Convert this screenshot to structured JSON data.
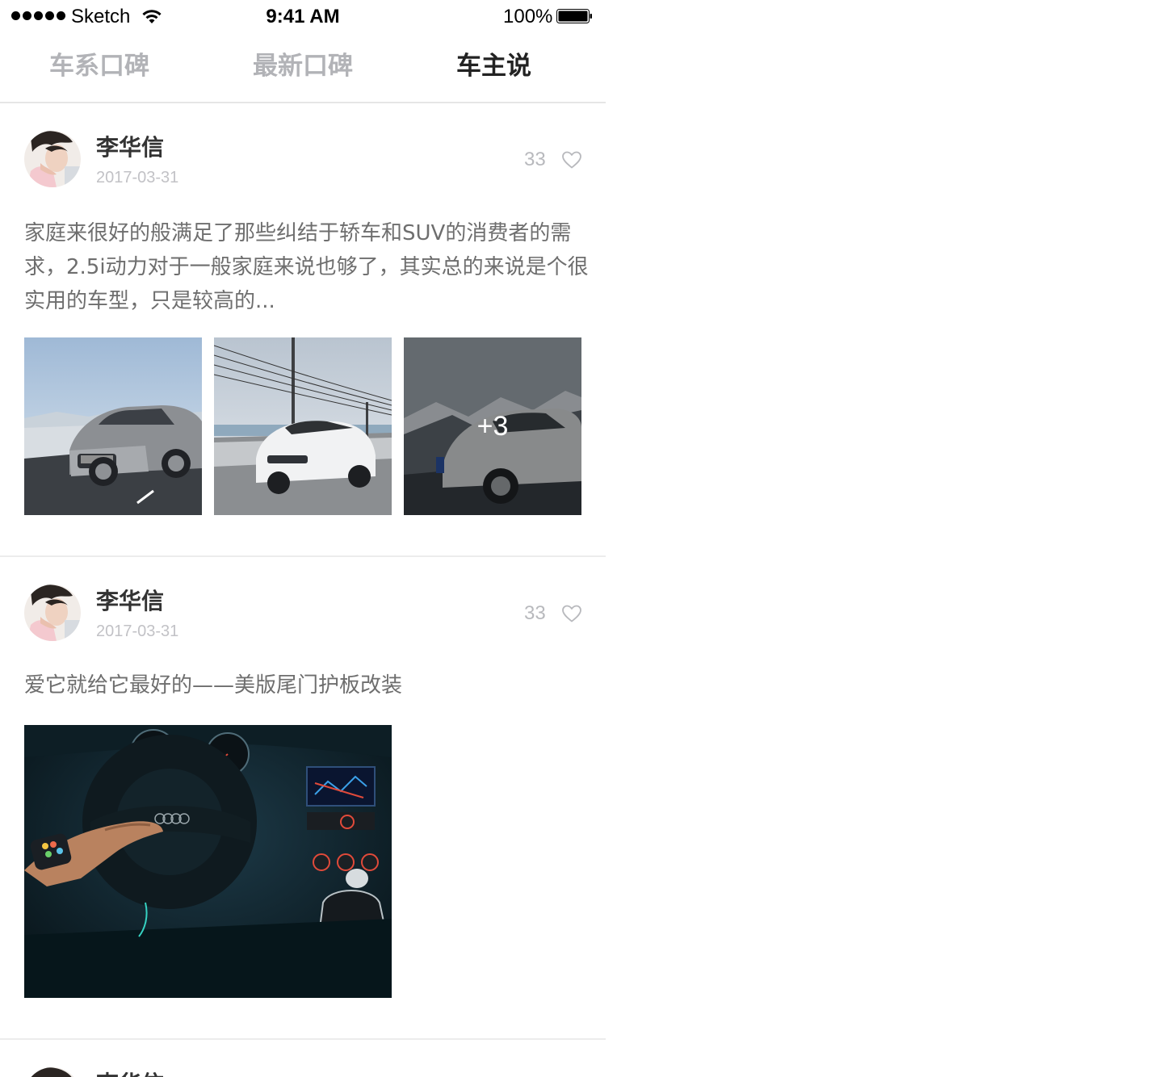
{
  "status_bar": {
    "carrier": "Sketch",
    "time": "9:41 AM",
    "battery": "100%"
  },
  "tabs": [
    {
      "label": "车系口碑",
      "active": false
    },
    {
      "label": "最新口碑",
      "active": false
    },
    {
      "label": "车主说",
      "active": true
    }
  ],
  "posts": [
    {
      "author": "李华信",
      "date": "2017-03-31",
      "likes": "33",
      "text": "家庭来很好的般满足了那些纠结于轿车和SUV的消费者的需求，2.5i动力对于一般家庭来说也够了，其实总的来说是个很实用的车型，只是较高的...",
      "more_count": "+3"
    },
    {
      "author": "李华信",
      "date": "2017-03-31",
      "likes": "33",
      "text": "爱它就给它最好的——美版尾门护板改装"
    },
    {
      "author": "李华信"
    }
  ],
  "colors": {
    "active_tab": "#222222",
    "inactive_tab": "#b2b3b7",
    "body_text": "#6e6e6e",
    "meta_text": "#c2c2c6",
    "divider": "#ececec"
  },
  "icons": [
    "signal-dots-icon",
    "wifi-icon",
    "battery-icon",
    "heart-outline-icon"
  ]
}
